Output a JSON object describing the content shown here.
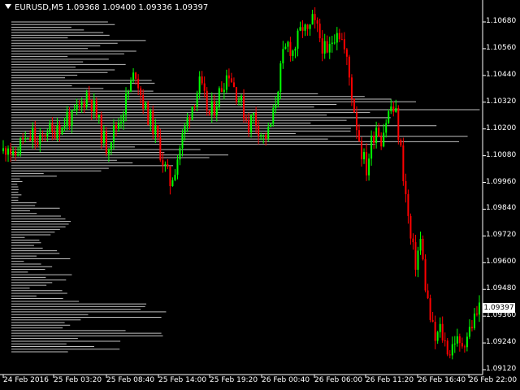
{
  "window": {
    "symbol_info": "EURUSD,M5  1.09368 1.09400 1.09336 1.09397",
    "menu_icon": "triangle-down-icon"
  },
  "colors": {
    "background": "#000000",
    "bull": "#00ff00",
    "bear": "#ff0000",
    "profile": "#c0c0c0",
    "axis": "#ffffff",
    "grid": "#404040"
  },
  "axis": {
    "y_labels": [
      "1.10680",
      "1.10560",
      "1.10440",
      "1.10320",
      "1.10200",
      "1.10080",
      "1.09960",
      "1.09840",
      "1.09720",
      "1.09600",
      "1.09480",
      "1.09360",
      "1.09240",
      "1.09120"
    ],
    "x_labels": [
      "24 Feb 2016",
      "25 Feb 03:20",
      "25 Feb 08:40",
      "25 Feb 14:00",
      "25 Feb 19:20",
      "26 Feb 00:40",
      "26 Feb 06:00",
      "26 Feb 11:20",
      "26 Feb 16:40",
      "26 Feb 22:00"
    ],
    "current_price": "1.09397"
  },
  "chart_data": {
    "type": "candlestick",
    "ylim": [
      1.091,
      1.1072
    ],
    "price_path": [
      1.101,
      1.1014,
      1.1006,
      1.1011,
      1.1016,
      1.1013,
      1.1018,
      1.1012,
      1.1016,
      1.1021,
      1.1017,
      1.1023,
      1.102,
      1.1026,
      1.1024,
      1.1028,
      1.1031,
      1.1036,
      1.1032,
      1.1026,
      1.1018,
      1.1012,
      1.1017,
      1.1021,
      1.1026,
      1.1033,
      1.104,
      1.1046,
      1.1036,
      1.1028,
      1.1024,
      1.1018,
      1.101,
      1.1002,
      1.0996,
      1.1003,
      1.1012,
      1.102,
      1.1028,
      1.1034,
      1.104,
      1.1033,
      1.1026,
      1.103,
      1.1036,
      1.1042,
      1.1046,
      1.1039,
      1.1034,
      1.1028,
      1.1022,
      1.1026,
      1.1021,
      1.1016,
      1.1018,
      1.1026,
      1.104,
      1.1052,
      1.1058,
      1.1055,
      1.106,
      1.1066,
      1.1062,
      1.1068,
      1.1064,
      1.1058,
      1.1052,
      1.106,
      1.1066,
      1.106,
      1.105,
      1.1036,
      1.1022,
      1.101,
      1.1002,
      1.1014,
      1.1022,
      1.1016,
      1.1024,
      1.103,
      1.1026,
      1.101,
      1.099,
      1.097,
      1.096,
      1.097,
      1.095,
      1.0935,
      1.0925,
      1.093,
      1.0924,
      1.092,
      1.0926,
      1.0922,
      1.0926,
      1.093,
      1.0935,
      1.094
    ],
    "profile": {
      "count": 125,
      "top_price": 1.1068,
      "bottom_price": 1.092,
      "low_volume_band": [
        1.0988,
        1.0998
      ]
    }
  }
}
